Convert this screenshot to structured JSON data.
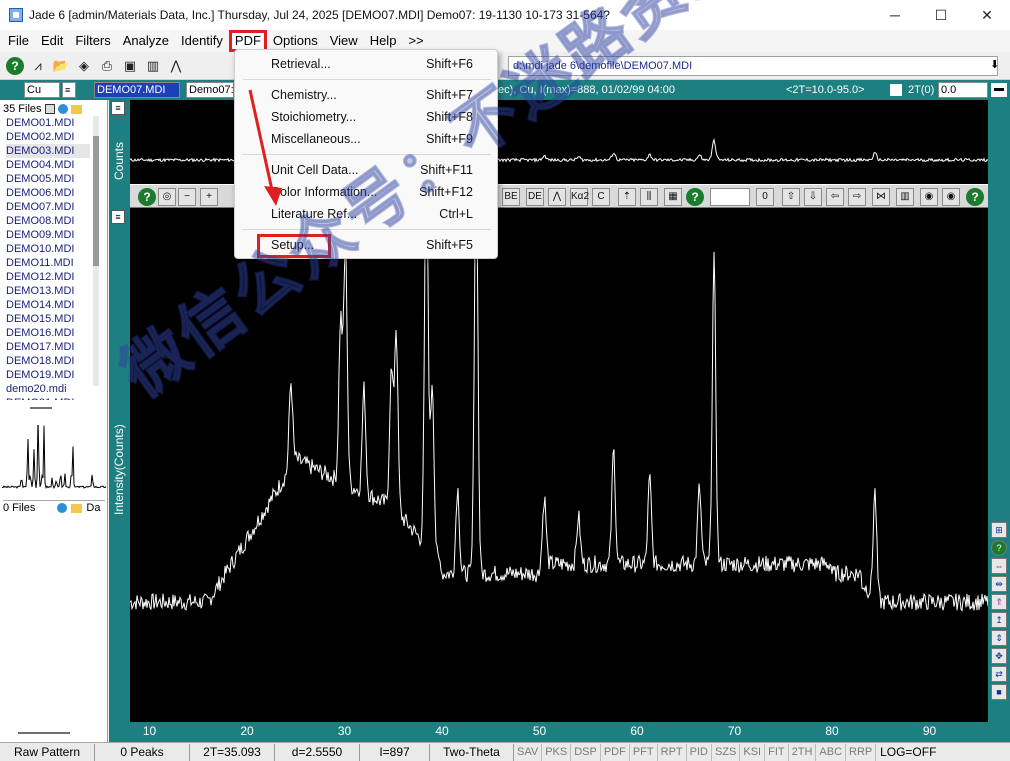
{
  "window": {
    "title": "Jade 6 [admin/Materials Data, Inc.] Thursday, Jul 24, 2025 [DEMO07.MDI] Demo07: 19-1130 10-173 31-564?",
    "minimize": "─",
    "maximize": "☐",
    "close": "✕"
  },
  "menubar": {
    "items": [
      "File",
      "Edit",
      "Filters",
      "Analyze",
      "Identify",
      "PDF",
      "Options",
      "View",
      "Help",
      ">>"
    ],
    "active": "PDF"
  },
  "toolbar": {
    "path": "d:\\mdi jade 6\\demofile\\DEMO07.MDI",
    "icons": [
      "help-icon",
      "pattern-icon",
      "open-file-icon",
      "edit-icon",
      "print-icon",
      "save-icon",
      "bar-chart-icon",
      "peak-icon"
    ]
  },
  "bar2": {
    "anode": "Cu",
    "file_select": "DEMO07.MDI",
    "demo_label": "Demo07:",
    "scan_info": "ec), Cu, I(max)=888, 01/02/99 04:00",
    "range": "<2T=10.0-95.0>",
    "twotheta_label": "2T(0)",
    "twotheta_value": "0.0"
  },
  "left_panel": {
    "files_count": "35 Files",
    "files": [
      "DEMO01.MDI",
      "DEMO02.MDI",
      "DEMO03.MDI",
      "DEMO04.MDI",
      "DEMO05.MDI",
      "DEMO06.MDI",
      "DEMO07.MDI",
      "DEMO08.MDI",
      "DEMO09.MDI",
      "DEMO10.MDI",
      "DEMO11.MDI",
      "DEMO12.MDI",
      "DEMO13.MDI",
      "DEMO14.MDI",
      "DEMO15.MDI",
      "DEMO16.MDI",
      "DEMO17.MDI",
      "DEMO18.MDI",
      "DEMO19.MDI",
      "demo20.mdi",
      "DEMO21.MDI"
    ],
    "selected_file": "DEMO03.MDI",
    "files2_count": "0 Files",
    "files2_col": "Da"
  },
  "plot": {
    "top_ylabel": "Counts",
    "main_ylabel": "Intensity(Counts)",
    "xticks": [
      "10",
      "20",
      "30",
      "40",
      "50",
      "60",
      "70",
      "80",
      "90"
    ],
    "marker_small": "≡"
  },
  "pdf_menu": {
    "items": [
      {
        "label": "Retrieval...",
        "shortcut": "Shift+F6"
      },
      {
        "label": "Chemistry...",
        "shortcut": "Shift+F7"
      },
      {
        "label": "Stoichiometry...",
        "shortcut": "Shift+F8"
      },
      {
        "label": "Miscellaneous...",
        "shortcut": "Shift+F9"
      },
      {
        "label": "Unit Cell Data...",
        "shortcut": "Shift+F11"
      },
      {
        "label": "Color Information...",
        "shortcut": "Shift+F12"
      },
      {
        "label": "Literature Ref...",
        "shortcut": "Ctrl+L"
      },
      {
        "label": "Setup...",
        "shortcut": "Shift+F5"
      }
    ]
  },
  "midbar": {
    "labels": [
      "BE",
      "DE",
      "Kα2",
      "C"
    ],
    "field_value": "0"
  },
  "status": {
    "mode": "Raw Pattern",
    "peaks": "0 Peaks",
    "twotheta": "2T=35.093",
    "d": "d=2.5550",
    "intensity": "I=897",
    "axis": "Two-Theta",
    "buttons": [
      "SAV",
      "PKS",
      "DSP",
      "PDF",
      "PFT",
      "RPT",
      "PID",
      "SZS",
      "KSI",
      "FIT",
      "2TH",
      "ABC",
      "RRP"
    ],
    "log": "LOG=OFF"
  },
  "watermark": "微信公众号：不迷路资源库"
}
